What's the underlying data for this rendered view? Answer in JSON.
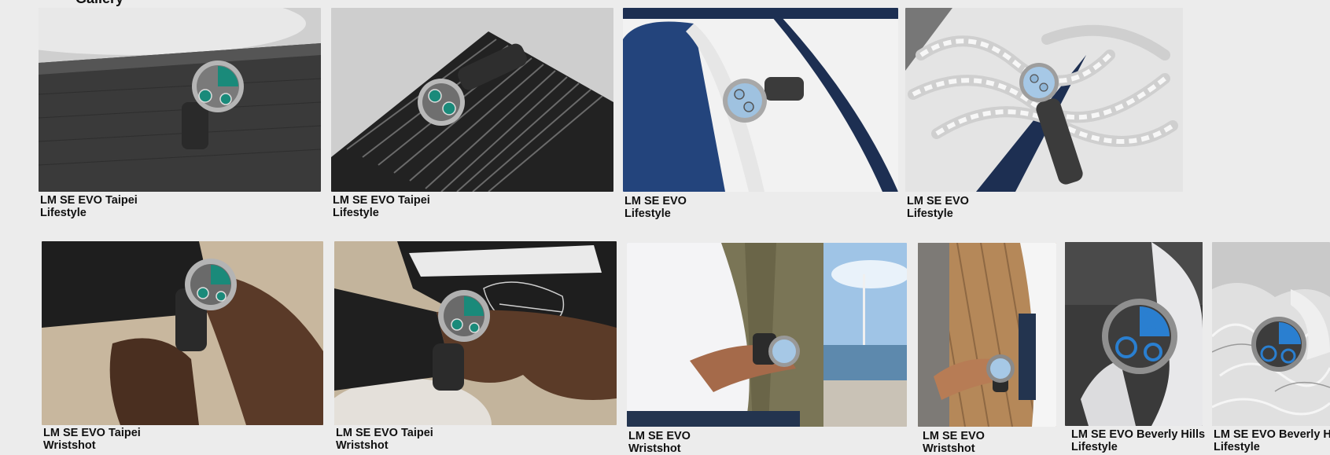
{
  "gallery": {
    "heading": "Gallery",
    "items": [
      {
        "title": "LM SE EVO Taipei",
        "category": "Lifestyle",
        "dial": "#1a8a7a",
        "scene": "dark-book"
      },
      {
        "title": "LM SE EVO Taipei",
        "category": "Lifestyle",
        "dial": "#1a8a7a",
        "scene": "striped-book"
      },
      {
        "title": "LM SE EVO",
        "category": "Lifestyle",
        "dial": "#8fb6d8",
        "scene": "boat-deck"
      },
      {
        "title": "LM SE EVO",
        "category": "Lifestyle",
        "dial": "#8fb6d8",
        "scene": "rope"
      },
      {
        "title": "LM SE EVO Taipei",
        "category": "Wristshot",
        "dial": "#1a8a7a",
        "scene": "wrist-beige"
      },
      {
        "title": "LM SE EVO Taipei",
        "category": "Wristshot",
        "dial": "#1a8a7a",
        "scene": "wrist-book"
      },
      {
        "title": "LM SE EVO",
        "category": "Wristshot",
        "dial": "#8fb6d8",
        "scene": "jacket-lake"
      },
      {
        "title": "LM SE EVO",
        "category": "Wristshot",
        "dial": "#8fb6d8",
        "scene": "wood-deck"
      },
      {
        "title": "LM SE EVO Beverly Hills",
        "category": "Lifestyle",
        "dial": "#2a7fd0",
        "scene": "dark-white-strap"
      },
      {
        "title": "LM SE EVO Beverly Hills",
        "category": "Lifestyle",
        "dial": "#2a7fd0",
        "scene": "silver-foil"
      }
    ]
  }
}
